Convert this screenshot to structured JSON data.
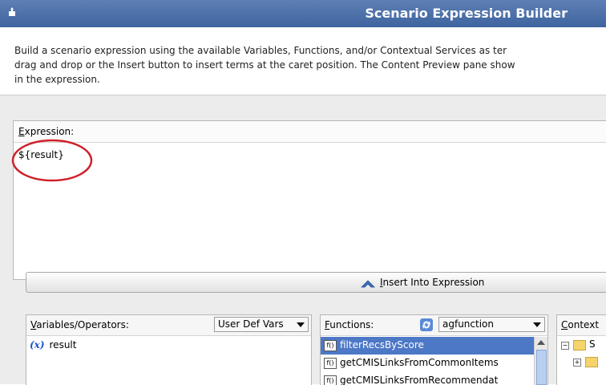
{
  "window": {
    "title": "Scenario Expression Builder"
  },
  "description": {
    "line1": "Build a scenario expression using the available Variables, Functions, and/or Contextual Services as ter",
    "line2": "drag and drop or the Insert button to insert terms at the caret position. The Content Preview pane show",
    "line3": "in the expression."
  },
  "expression": {
    "label_mnemonic": "E",
    "label_rest": "xpression:",
    "value": "${result}"
  },
  "insert_button": {
    "mnemonic": "I",
    "label_rest": "nsert Into Expression"
  },
  "variables": {
    "label_mnemonic": "V",
    "label_rest": "ariables/Operators:",
    "dropdown_value": "User Def Vars",
    "items": [
      {
        "icon": "(x)",
        "label": "result"
      }
    ]
  },
  "functions": {
    "label_mnemonic": "F",
    "label_rest": "unctions:",
    "dropdown_value": "agfunction",
    "items": [
      {
        "label": "filterRecsByScore",
        "selected": true
      },
      {
        "label": "getCMISLinksFromCommonItems",
        "selected": false
      },
      {
        "label": "getCMISLinksFromRecommendat",
        "selected": false
      }
    ]
  },
  "context": {
    "label_mnemonic": "C",
    "label_rest": "ontext",
    "tree_root_label": "S"
  },
  "colors": {
    "titlebar": "#4a6fa8",
    "selection": "#4c78c6",
    "annotation_circle": "#d0202a"
  }
}
